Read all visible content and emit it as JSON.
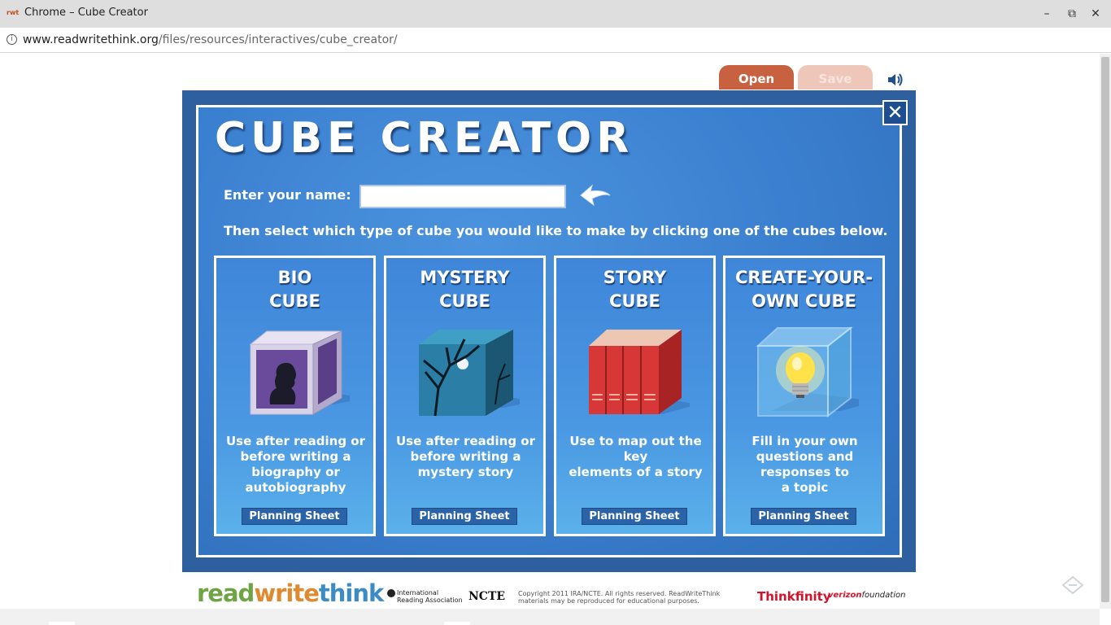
{
  "browser": {
    "title": "Chrome – Cube Creator",
    "favicon_text": "rwt",
    "url_domain": "www.readwritethink.org",
    "url_path": "/files/resources/interactives/cube_creator/"
  },
  "toolbar": {
    "open_label": "Open",
    "save_label": "Save"
  },
  "app": {
    "title": "CUBE CREATOR",
    "name_label": "Enter your name:",
    "name_value": "",
    "instruction": "Then select which type of cube you would like to make by clicking one of the cubes below."
  },
  "cubes": [
    {
      "title": "BIO\nCUBE",
      "description": "Use after reading or\nbefore writing a\nbiography or\nautobiography",
      "planning": "Planning Sheet"
    },
    {
      "title": "MYSTERY\nCUBE",
      "description": "Use after reading or\nbefore writing a\nmystery story",
      "planning": "Planning Sheet"
    },
    {
      "title": "STORY\nCUBE",
      "description": "Use to map out the key\nelements of a story",
      "planning": "Planning Sheet"
    },
    {
      "title": "CREATE-YOUR-\nOWN CUBE",
      "description": "Fill in your own\nquestions and\nresponses to\na topic",
      "planning": "Planning Sheet"
    }
  ],
  "footer": {
    "logo_read": "read",
    "logo_write": "write",
    "logo_think": "think",
    "ira": "International\nReading Association",
    "ncte": "NCTE",
    "copyright": "Copyright 2011 IRA/NCTE. All rights reserved. ReadWriteThink materials may be reproduced for educational purposes.",
    "thinkfinity": "Thinkfinity",
    "verizon": "verizon",
    "verizon_suffix": "foundation"
  },
  "colors": {
    "accent_open": "#c8613f",
    "panel_blue": "#3a7fcf",
    "frame_blue": "#2e5f9e"
  }
}
